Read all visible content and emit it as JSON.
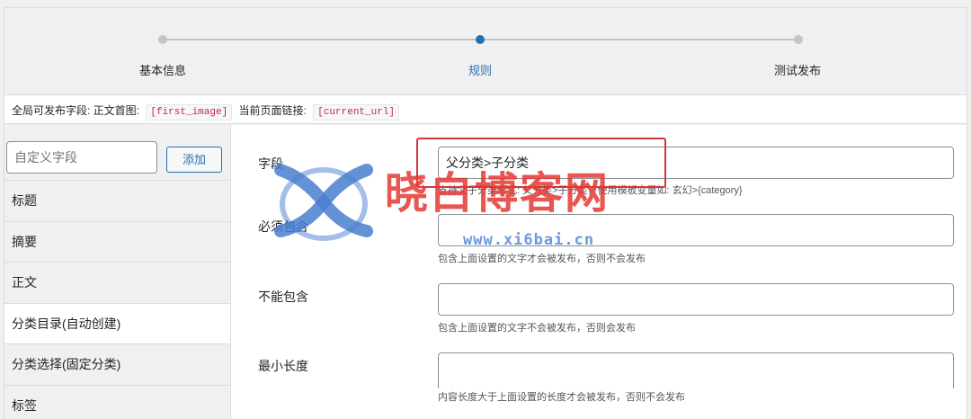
{
  "stepper": {
    "steps": [
      {
        "label": "基本信息",
        "active": false
      },
      {
        "label": "规则",
        "active": true
      },
      {
        "label": "测试发布",
        "active": false
      }
    ]
  },
  "global_fields": {
    "prefix": "全局可发布字段: 正文首图:",
    "tag1": "[first_image]",
    "mid": "当前页面链接:",
    "tag2": "[current_url]"
  },
  "sidebar": {
    "custom_field_placeholder": "自定义字段",
    "add_label": "添加",
    "items": [
      {
        "label": "标题"
      },
      {
        "label": "摘要"
      },
      {
        "label": "正文"
      },
      {
        "label": "分类目录(自动创建)"
      },
      {
        "label": "分类选择(固定分类)"
      },
      {
        "label": "标签"
      }
    ]
  },
  "form": {
    "fields": [
      {
        "label": "字段",
        "value": "父分类>子分类",
        "desc": "支持父子分类形式: 父分类>子分类，使用模板变量如: 玄幻>{category}"
      },
      {
        "label": "必须包含",
        "value": "",
        "desc": "包含上面设置的文字才会被发布，否则不会发布"
      },
      {
        "label": "不能包含",
        "value": "",
        "desc": "包含上面设置的文字不会被发布，否则会发布"
      },
      {
        "label": "最小长度",
        "value": "",
        "desc": "内容长度大于上面设置的长度才会被发布，否则不会发布"
      }
    ]
  },
  "watermark": {
    "text": "晓白博客网",
    "url": "www.xi6bai.cn"
  },
  "colors": {
    "accent": "#2271b1",
    "highlight": "#d63638",
    "watermark_red": "#e53935",
    "watermark_blue": "#5b8fd9"
  }
}
